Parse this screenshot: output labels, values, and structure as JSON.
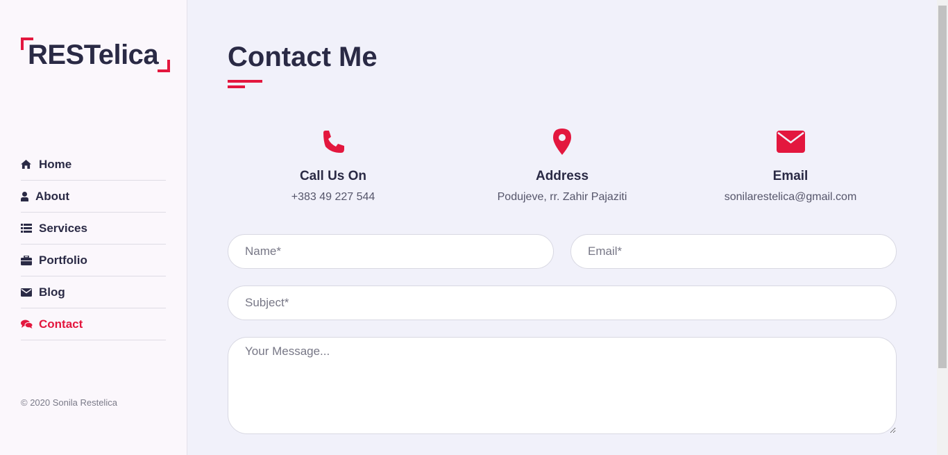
{
  "brand": {
    "logo_text": "RESTelica"
  },
  "sidebar": {
    "items": [
      {
        "label": "Home",
        "icon": "home-icon"
      },
      {
        "label": "About",
        "icon": "user-icon"
      },
      {
        "label": "Services",
        "icon": "list-icon"
      },
      {
        "label": "Portfolio",
        "icon": "briefcase-icon"
      },
      {
        "label": "Blog",
        "icon": "envelope-icon"
      },
      {
        "label": "Contact",
        "icon": "comments-icon",
        "active": true
      }
    ],
    "copyright": "© 2020 Sonila Restelica"
  },
  "main": {
    "title": "Contact Me",
    "info": [
      {
        "heading": "Call Us On",
        "value": "+383 49 227 544",
        "icon": "phone-icon"
      },
      {
        "heading": "Address",
        "value": "Podujeve, rr. Zahir Pajaziti",
        "icon": "map-marker-icon"
      },
      {
        "heading": "Email",
        "value": "sonilarestelica@gmail.com",
        "icon": "mail-icon"
      }
    ],
    "form": {
      "name_placeholder": "Name*",
      "email_placeholder": "Email*",
      "subject_placeholder": "Subject*",
      "message_placeholder": "Your Message..."
    }
  },
  "colors": {
    "accent": "#e3173e",
    "text": "#2a2a45",
    "background": "#f1f1fa",
    "sidebar_bg": "#fbf7fc"
  }
}
